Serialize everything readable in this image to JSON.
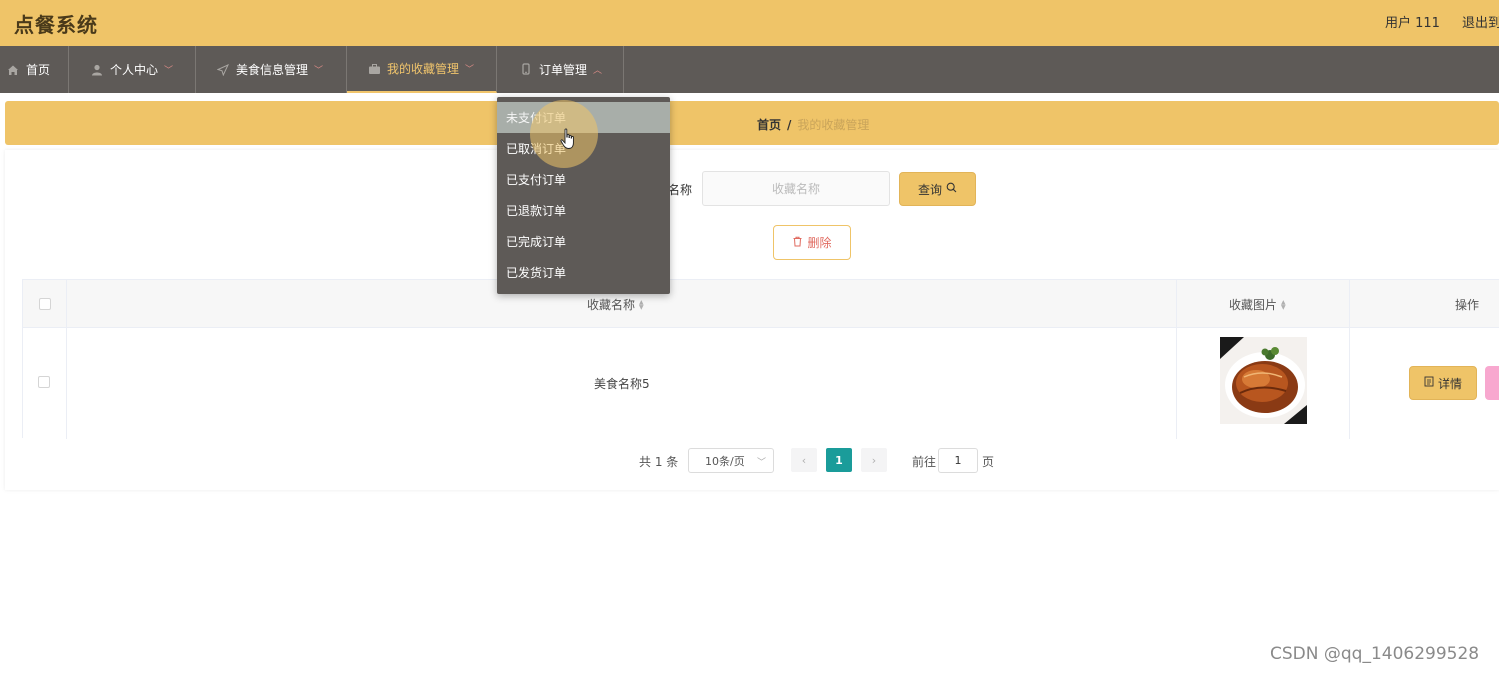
{
  "header": {
    "app_title": "点餐系统",
    "user_label": "用户 111",
    "logout_label": "退出到"
  },
  "nav": {
    "items": [
      {
        "label": "首页",
        "icon": "home-icon"
      },
      {
        "label": "个人中心",
        "icon": "user-icon"
      },
      {
        "label": "美食信息管理",
        "icon": "send-icon"
      },
      {
        "label": "我的收藏管理",
        "icon": "briefcase-icon",
        "active": true
      },
      {
        "label": "订单管理",
        "icon": "phone-icon",
        "expanded": true
      }
    ]
  },
  "breadcrumb": {
    "home": "首页",
    "separator": "/",
    "current": "我的收藏管理"
  },
  "search": {
    "label": "名称",
    "placeholder": "收藏名称",
    "query_label": "查询"
  },
  "actions": {
    "delete_label": "删除",
    "detail_label": "详情"
  },
  "table": {
    "columns": [
      "收藏名称",
      "收藏图片",
      "操作"
    ],
    "rows": [
      {
        "name": "美食名称5",
        "image": "braised-pork-dish"
      }
    ]
  },
  "pagination": {
    "total": "共 1 条",
    "page_size": "10条/页",
    "current_page": "1",
    "goto_label": "前往",
    "jump_value": "1",
    "page_suffix": "页",
    "prev": "‹",
    "next": "›"
  },
  "dropdown": {
    "items": [
      "未支付订单",
      "已取消订单",
      "已支付订单",
      "已退款订单",
      "已完成订单",
      "已发货订单"
    ],
    "hovered_index": 0
  },
  "watermark": "CSDN @qq_1406299528",
  "colors": {
    "accent": "#efc468",
    "nav_bg": "#5e5a57",
    "page_active": "#1a9c9a",
    "danger": "#e06a5f"
  }
}
